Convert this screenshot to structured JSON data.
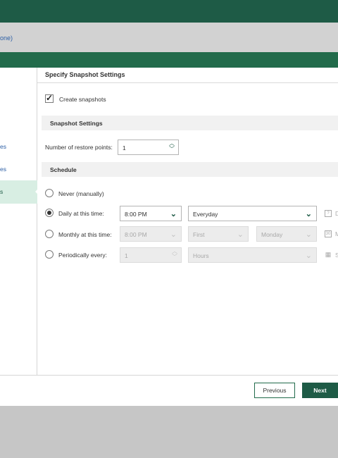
{
  "breadcrumb": {
    "text": "one)"
  },
  "nav": {
    "item1": "es",
    "item2": "es",
    "active": "s"
  },
  "page": {
    "title": "Specify Snapshot Settings"
  },
  "create_snapshots": {
    "label": "Create snapshots",
    "checked": true
  },
  "snapshot_settings": {
    "heading": "Snapshot Settings",
    "restore_points_label": "Number of restore points:",
    "restore_points_value": "1"
  },
  "schedule": {
    "heading": "Schedule",
    "never_label": "Never (manually)",
    "daily": {
      "label": "Daily at this time:",
      "time": "8:00 PM",
      "frequency": "Everyday",
      "trailing_text": "D"
    },
    "monthly": {
      "label": "Monthly at this time:",
      "time": "8:00 PM",
      "week": "First",
      "day": "Monday",
      "trailing_text": "M",
      "icon_text": "30"
    },
    "periodic": {
      "label": "Periodically every:",
      "value": "1",
      "unit": "Hours",
      "trailing_text": "S"
    },
    "selected": "daily"
  },
  "buttons": {
    "previous": "Previous",
    "next": "Next"
  },
  "colors": {
    "brand_dark": "#1e5b46",
    "link_blue": "#2d5fa6",
    "nav_active_bg": "#d8eee3"
  }
}
